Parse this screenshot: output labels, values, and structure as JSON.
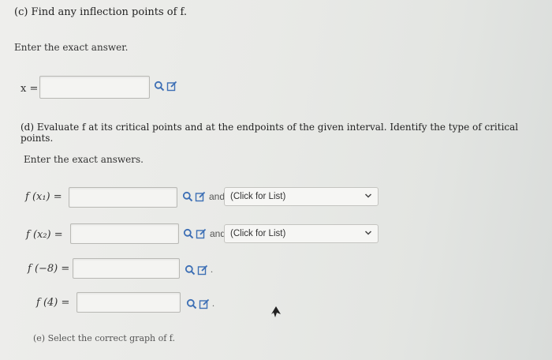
{
  "part_c": {
    "title": "(c) Find any inflection points of f.",
    "instruction": "Enter the exact answer.",
    "row": {
      "label": "x =",
      "value": ""
    }
  },
  "part_d": {
    "title": "(d) Evaluate f at its critical points and at the endpoints of the given interval. Identify the type of critical points.",
    "instruction": "Enter the exact answers.",
    "rows": [
      {
        "label": "f (x₁) =",
        "value": "",
        "and": "and",
        "select": "(Click for List)"
      },
      {
        "label": "f (x₂) =",
        "value": "",
        "and": "and",
        "select": "(Click for List)"
      },
      {
        "label": "f (−8) =",
        "value": "",
        "suffix": "."
      },
      {
        "label": "f (4) =",
        "value": "",
        "suffix": "."
      }
    ]
  },
  "part_e": {
    "title": "(e) Select the correct graph of f."
  },
  "icons": [
    "search-icon",
    "edit-icon",
    "chevron-down-icon"
  ],
  "colors": {
    "icon": "#3d6fb5",
    "field_border": "#b9b9b5"
  }
}
